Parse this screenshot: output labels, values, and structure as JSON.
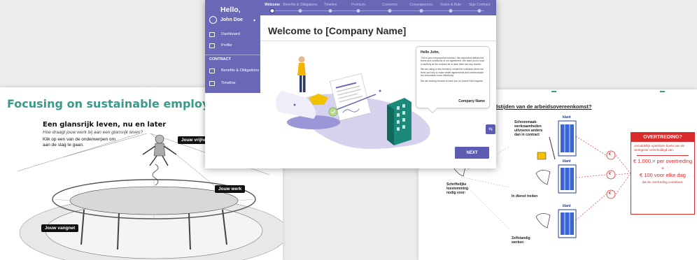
{
  "left": {
    "title": "Focusing on sustainable employability",
    "heading": "Een glansrijk leven, nu en later",
    "subtitle": "Hoe draagt jouw werk bij aan een glansrijk leven?",
    "instruction": "Klik op een van de onderwerpen om aan de slag te gaan.",
    "tags": {
      "vrijheid": "Jouw vrijheid",
      "werk": "Jouw werk",
      "vangnet": "Jouw vangnet"
    },
    "accent": "#3a9a8a"
  },
  "right": {
    "heading": "ns arbeidstijden van de arbeidsovereenkomst?",
    "labels": {
      "schoonmaak": "Schoonmaak- werkzaamheden uitvoeren anders dan in contract",
      "schriftelijk": "Schriftelijke toestemming nodig voor:",
      "dienst": "In dienst treden",
      "zelfstandig": "Zelfstandig werken",
      "klant": "klant"
    },
    "overtreding": {
      "title": "OVERTREDING?",
      "small": "onmiddellijk opeisbare boete aan de werkgever verschuldigd van:",
      "amount1": "€ 1.000,= per overtreding",
      "plus": "+",
      "amount2": "€ 100 voor elke dag",
      "amount2_suffix": "dat de overtreding voortduurt."
    },
    "euro": "€",
    "accent": "#d92b2b"
  },
  "app": {
    "hello": "Hello,",
    "user": "John Doe",
    "nav": [
      {
        "label": "Dashboard"
      },
      {
        "label": "Profile"
      }
    ],
    "section": "CONTRACT",
    "nav2": [
      {
        "label": "Benefits & Obligations"
      },
      {
        "label": "Timeline"
      }
    ],
    "steps": [
      {
        "label": "Welcome",
        "active": true
      },
      {
        "label": "Benefits & Obligations",
        "active": false
      },
      {
        "label": "Timeline",
        "active": false
      },
      {
        "label": "Premium",
        "active": false
      },
      {
        "label": "Concerns",
        "active": false
      },
      {
        "label": "Consequences",
        "active": false
      },
      {
        "label": "Vision & Rule",
        "active": false
      },
      {
        "label": "Sign Contract",
        "active": false
      }
    ],
    "title": "Welcome to [Company Name]",
    "letter": {
      "greeting": "Hello John,",
      "p1": "This is your employment contract, this document defines the terms and conditions of our agreement. We want you to read it carefully at the contract as in case there are any doubts.",
      "p2": "We are using a new format to create the contracts which we think can help to make better agreements and communicate the information more effectively.",
      "p3": "We are looking forward to have you on board! Kind regards,",
      "sign": "Company Name"
    },
    "next_label": "NEXT",
    "accent": "#6868b7"
  }
}
